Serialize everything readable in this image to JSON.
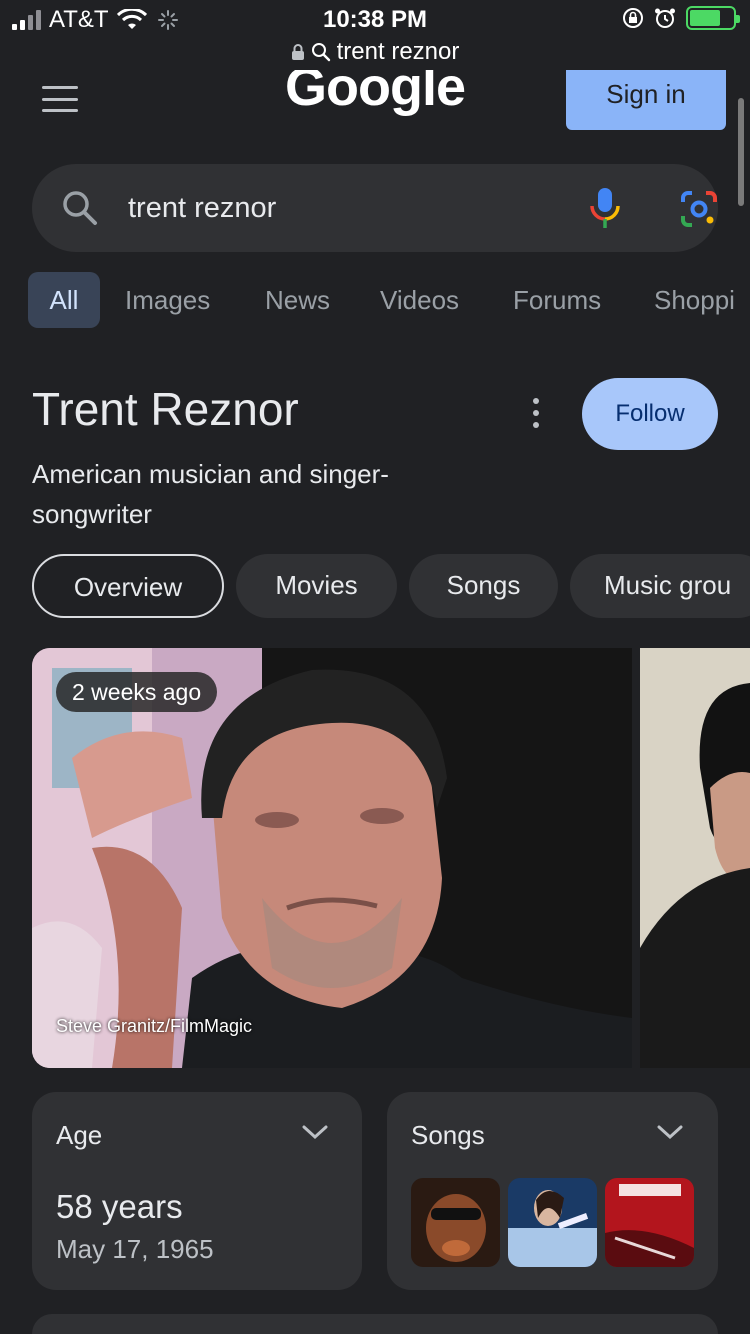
{
  "status_bar": {
    "carrier": "AT&T",
    "time": "10:38 PM",
    "battery_color": "#4cd964"
  },
  "browser": {
    "url": "trent reznor"
  },
  "header": {
    "logo": "Google",
    "sign_in_label": "Sign in"
  },
  "search": {
    "query": "trent reznor"
  },
  "tabs": [
    "All",
    "Images",
    "News",
    "Videos",
    "Forums",
    "Shoppi"
  ],
  "knowledge_panel": {
    "title": "Trent Reznor",
    "subtitle": "American musician and singer-songwriter",
    "follow_label": "Follow",
    "chips": [
      "Overview",
      "Movies",
      "Songs",
      "Music grou"
    ]
  },
  "image": {
    "badge": "2 weeks ago",
    "credit": "Steve Granitz/FilmMagic"
  },
  "cards": {
    "age": {
      "title": "Age",
      "value": "58 years",
      "date": "May 17, 1965"
    },
    "songs": {
      "title": "Songs"
    }
  },
  "colors": {
    "background": "#202124",
    "surface": "#303134",
    "accent": "#8ab4f8",
    "active_tab": "#394457"
  }
}
